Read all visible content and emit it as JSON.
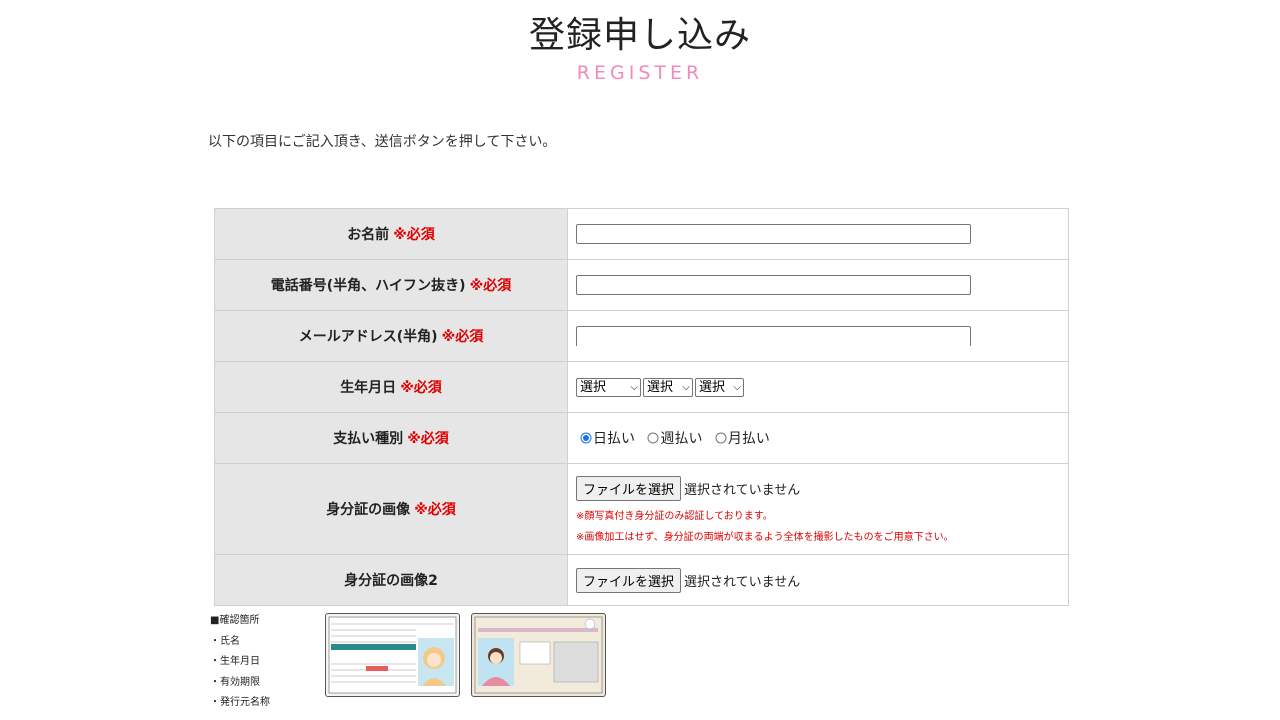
{
  "page": {
    "title": "登録申し込み",
    "subtitle": "REGISTER",
    "intro": "以下の項目にご記入頂き、送信ボタンを押して下さい。"
  },
  "form": {
    "required_mark": "※必須",
    "name_label": "お名前",
    "phone_label": "電話番号(半角、ハイフン抜き)",
    "email_label": "メールアドレス(半角)",
    "birth_label": "生年月日",
    "birth_selects": [
      "選択",
      "選択",
      "選択"
    ],
    "payment_label": "支払い種別",
    "payment_options": [
      "日払い",
      "週払い",
      "月払い"
    ],
    "payment_selected": "日払い",
    "id_image_label": "身分証の画像",
    "id_image2_label": "身分証の画像2",
    "file_button": "ファイルを選択",
    "no_file": "選択されていません",
    "note1": "※顔写真付き身分証のみ認証しております。",
    "note2": "※画像加工はせず、身分証の両端が収まるよう全体を撮影したものをご用意下さい。"
  },
  "checklist": {
    "items": [
      "■確認箇所",
      "・氏名",
      "・生年月日",
      "・有効期限",
      "・発行元名称"
    ]
  },
  "colors": {
    "accent_pink": "#f08bb7",
    "required_red": "#e00000",
    "label_bg": "#e6e6e6"
  }
}
